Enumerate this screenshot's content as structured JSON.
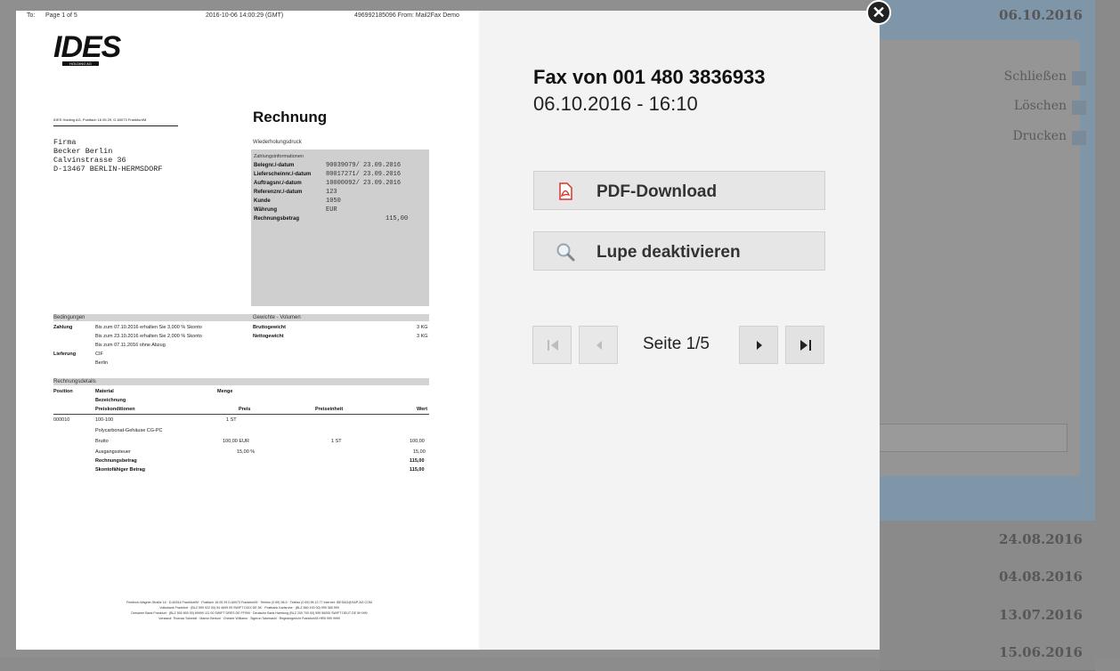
{
  "background": {
    "links": [
      "Schließen",
      "Löschen",
      "Drucken"
    ],
    "top_date": "06.10.2016",
    "list_dates": [
      "24.08.2016",
      "04.08.2016",
      "13.07.2016",
      "15.06.2016"
    ]
  },
  "modal": {
    "close_glyph": "✕",
    "fax_doc": {
      "header": {
        "to": "To:",
        "page": "Page 1 of 5",
        "datetime": "2016-10-06 14:00:29 (GMT)",
        "from": "496992185096  From: Mail2Fax Demo"
      },
      "logo": "IDES",
      "logo_sub": "HOLDING AG",
      "sender_line": "IDES Holding AG, Postfach 16 05 29, D-60073 Frankfurt/M",
      "title": "Rechnung",
      "address": "Firma\nBecker Berlin\nCalvinstrasse 36\nD-13467 BERLIN-HERMSDORF",
      "repeat_print": "Wiederholungsdruck",
      "info_head": "Zahlungsinformationen",
      "info_rows": [
        {
          "label": "Belegnr./-datum",
          "value": "90039079/ 23.09.2016"
        },
        {
          "label": "Lieferscheinnr./-datum",
          "value": "80017271/ 23.09.2016"
        },
        {
          "label": "Auftragsnr./-datum",
          "value": "10000092/ 23.09.2016"
        },
        {
          "label": "Referenznr./-datum",
          "value": "123"
        },
        {
          "label": "Kunde",
          "value": "1050"
        },
        {
          "label": "Währung",
          "value": "EUR"
        },
        {
          "label": "Rechnungsbetrag",
          "value": "115,00"
        }
      ],
      "conditions_title": "Bedingungen",
      "weights_title": "Gewichte - Volumen",
      "payment_label": "Zahlung",
      "payment_lines": [
        "Bis zum 07.10.2016 erhalten Sie 3,000  % Skonto",
        "Bis zum 23.10.2016 erhalten Sie 2,000  % Skonto",
        "Bis zum 07.11.2016 ohne Abzug"
      ],
      "delivery_label": "Lieferung",
      "delivery_lines": [
        "CIF",
        "Berlin"
      ],
      "gross_label": "Bruttogewicht",
      "gross_value": "3 KG",
      "net_label": "Nettogewicht",
      "net_value": "3 KG",
      "details_title": "Rechnungsdetails",
      "col_position": "Position",
      "col_material": "Material",
      "col_menge": "Menge",
      "col_bezeichnung": "Bezeichnung",
      "col_preiskond": "Preiskonditionen",
      "col_preis": "Preis",
      "col_preiseinheit": "Preiseinheit",
      "col_wert": "Wert",
      "item_pos": "000010",
      "item_material": "100-100",
      "item_qty": "1  ST",
      "item_desc": "Polycarbonat-Gehäuse CG-PC",
      "brutto_label": "Brutto",
      "brutto_price": "100,00  EUR",
      "brutto_unit": "1  ST",
      "brutto_value": "100,00",
      "tax_label": "Ausgangssteuer",
      "tax_rate": "15,00    %",
      "tax_value": "15,00",
      "total_label": "Rechnungsbetrag",
      "total_value": "115,00",
      "skonto_label": "Skontofähiger Betrag",
      "skonto_value": "115,00",
      "footer_lines": [
        "Friedrich-Wagner-Straße 16 · D-60316 Frankfurt/M · Postfach 16 05 29 D-60073 Frankfurt/M · Telefon (0 69) 98-0 · Telefax (0 69) 98 13 77 Internet: IDESAG@SAP-AG.COM",
        "Volksbank Frankfurt · (BLZ 599 922 00) 54 4699 09 SWIFT DIXX DE 5K · Postbank Karlsruhe · (BLZ 660 100 00) 999 365 999",
        "Dresdner Bank Frankfurt · (BLZ 500 800 00) 69999 111 00 SWIFT DRES DE FF999 · Deutsche Bank Hamburg (BLZ 200 700 00) 599 56005 SWIFT DEUT DE 5H 999",
        "Vorstand: Thomas Schmidt · Marion Bertoni · Chester Williams · Sigerun Takehashi · Registergericht Frankfurt/M HRB 999 9999"
      ]
    },
    "side": {
      "title": "Fax von 001 480 3836933",
      "datetime": "06.10.2016 - 16:10",
      "pdf_button": "PDF-Download",
      "zoom_button": "Lupe deaktivieren",
      "page_indicator": "Seite 1/5",
      "colors": {
        "panel_bg": "#f3f3f3",
        "button_bg": "#e6e6e6",
        "pdf_icon": "#d9352b"
      }
    }
  }
}
